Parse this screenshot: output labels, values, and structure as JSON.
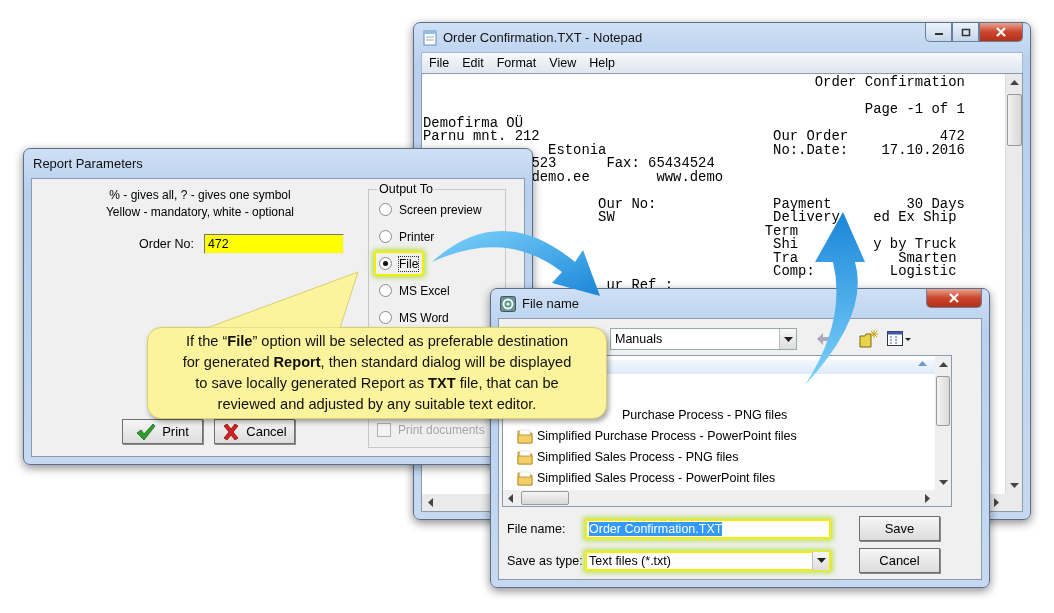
{
  "notepad": {
    "title": "Order Confirmation.TXT - Notepad",
    "menu": [
      "File",
      "Edit",
      "Format",
      "View",
      "Help"
    ],
    "lines": [
      {
        "text": "                                               Order Confirmation"
      },
      {
        "text": "                                                     Page -1 of 1",
        "blank_before": true
      },
      {
        "text": "Demofirma OÜ"
      },
      {
        "text": "Parnu mnt. 212                            Our Order           472"
      },
      {
        "text": "               Estonia                    No:.Date:    17.10.2016"
      },
      {
        "text": "             523      Fax: 65434524"
      },
      {
        "text": "             demo.ee        www.demo"
      },
      {
        "text": "                     Our No:              Payment         30 Days",
        "blank_before": true
      },
      {
        "text": "                     SW                   Delivery    ed Ex Ship"
      },
      {
        "text": "                                         Term"
      },
      {
        "text": "                                          Shi         y by Truck"
      },
      {
        "text": "                                          Tra            Smarten"
      },
      {
        "text": "                                          Comp:         Logistic"
      },
      {
        "text": "                      ur Ref :"
      }
    ]
  },
  "report_dialog": {
    "title": "Report Parameters",
    "hints": [
      "% - gives all, ? - gives one symbol",
      "Yellow - mandatory, white - optional"
    ],
    "order_no": {
      "label": "Order No:",
      "value": "472",
      "mandatory": true
    },
    "output": {
      "legend": "Output To",
      "options": [
        {
          "label": "Screen preview",
          "selected": false,
          "highlighted": false
        },
        {
          "label": "Printer",
          "selected": false,
          "highlighted": false
        },
        {
          "label": "File",
          "selected": true,
          "highlighted": true
        },
        {
          "label": "MS Excel",
          "selected": false,
          "highlighted": false
        },
        {
          "label": "MS Word",
          "selected": false,
          "highlighted": false
        }
      ],
      "print_documents": {
        "label": "Print documents",
        "checked": false,
        "disabled": true
      }
    },
    "buttons": [
      {
        "label": "Print",
        "kind": "ok"
      },
      {
        "label": "Cancel",
        "kind": "cancel"
      }
    ]
  },
  "callout": {
    "lines": [
      "If the “**File**” option will be selected as preferable destination",
      "for generated **Report**, then standard dialog will be displayed",
      "to save locally generated Report as **TXT** file, that can be",
      "reviewed and adjusted by any suitable text editor."
    ]
  },
  "file_dialog": {
    "title": "File name",
    "location": "Manuals",
    "items": [
      {
        "name": "Purchase Process - PNG files",
        "kind": "partial"
      },
      {
        "name": "Simplified Purchase Process - PowerPoint files",
        "kind": "folder"
      },
      {
        "name": "Simplified Sales Process - PNG files",
        "kind": "folder"
      },
      {
        "name": "Simplified Sales Process - PowerPoint files",
        "kind": "folder"
      }
    ],
    "file_name": {
      "label": "File name:",
      "value": "Order Confirmation.TXT",
      "highlighted": true
    },
    "save_type": {
      "label": "Save as type:",
      "value": "Text files (*.txt)",
      "highlighted": true
    },
    "buttons": [
      "Save",
      "Cancel"
    ]
  }
}
